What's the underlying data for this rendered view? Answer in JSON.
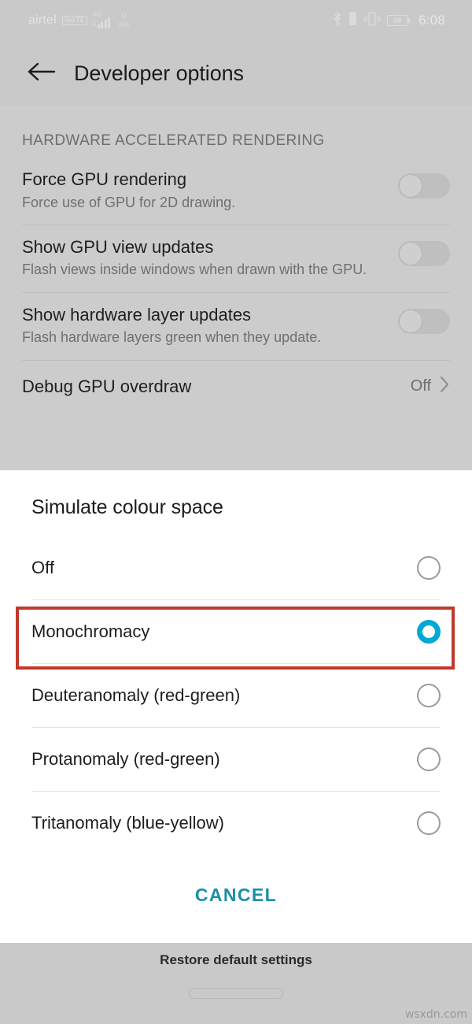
{
  "status_bar": {
    "carrier": "airtel",
    "volte_badge": "VoLTE",
    "network_type": "4G",
    "network_sub": "1",
    "data_speed_value": "0",
    "data_speed_unit": "K/s",
    "bluetooth_icon": "bluetooth-icon",
    "sim_icon": "sim-card-icon",
    "vibrate_icon": "vibrate-icon",
    "battery_level": "58",
    "time": "6:08"
  },
  "app_bar": {
    "back_icon": "arrow-left-icon",
    "title": "Developer options"
  },
  "settings": {
    "section_header": "HARDWARE ACCELERATED RENDERING",
    "rows": [
      {
        "title": "Force GPU rendering",
        "subtitle": "Force use of GPU for 2D drawing.",
        "control": "switch",
        "checked": false
      },
      {
        "title": "Show GPU view updates",
        "subtitle": "Flash views inside windows when drawn with the GPU.",
        "control": "switch",
        "checked": false
      },
      {
        "title": "Show hardware layer updates",
        "subtitle": "Flash hardware layers green when they update.",
        "control": "switch",
        "checked": false
      },
      {
        "title": "Debug GPU overdraw",
        "subtitle": "",
        "control": "value",
        "value": "Off",
        "chevron_icon": "chevron-right-icon"
      }
    ]
  },
  "dialog": {
    "title": "Simulate colour space",
    "options": [
      {
        "label": "Off",
        "selected": false
      },
      {
        "label": "Monochromacy",
        "selected": true
      },
      {
        "label": "Deuteranomaly (red-green)",
        "selected": false
      },
      {
        "label": "Protanomaly (red-green)",
        "selected": false
      },
      {
        "label": "Tritanomaly (blue-yellow)",
        "selected": false
      }
    ],
    "cancel_label": "CANCEL",
    "selected_index": 1,
    "accent_color": "#00a8d6",
    "cancel_color": "#1a8fa8",
    "highlight_color": "#c0392b"
  },
  "bottom_bar": {
    "restore_label": "Restore default settings",
    "gesture_pill": "home-gesture-pill",
    "watermark": "wsxdn.com"
  }
}
